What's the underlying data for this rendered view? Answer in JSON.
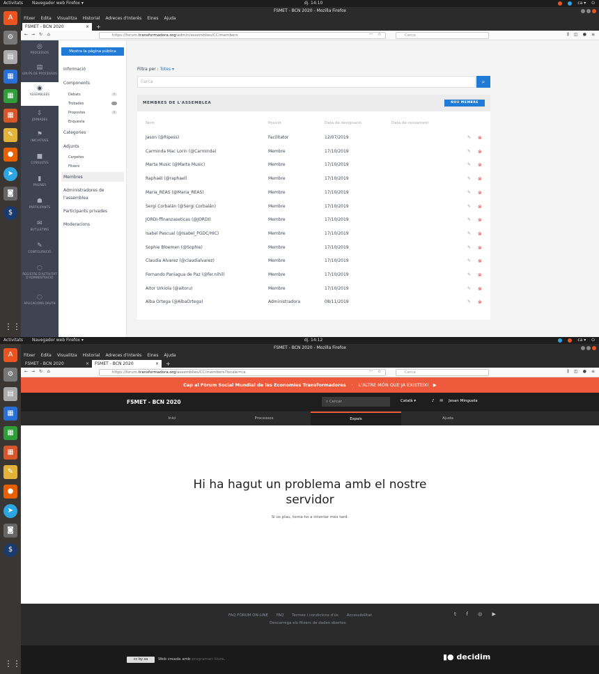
{
  "desktop": {
    "activities": "Activitats",
    "app_label": "Navegador web Firefox ▾",
    "shot1_time": "dj. 14:10",
    "shot2_time": "dj. 14:12",
    "tray_lang": "ca ▾",
    "window_title": "FSMET - BCN 2020 - Mozilla Firefox"
  },
  "browser": {
    "menu": [
      "Fitxer",
      "Edita",
      "Visualitza",
      "Historial",
      "Adreces d'interès",
      "Eines",
      "Ajuda"
    ],
    "tab1_label": "FSMET - BCN 2020",
    "tab_close": "×",
    "newtab": "+",
    "url1_pre": "https://forum.",
    "url1_host": "transformadora.org",
    "url1_path": "/admin/assemblies/CC/members",
    "url2_pre": "https://forum.",
    "url2_host": "transformadora.org",
    "url2_path": "/assemblies/CC/members?locale=ca",
    "search_placeholder": "Cerca"
  },
  "admin": {
    "sidebar": [
      {
        "label": "PROCESSOS",
        "icon": "◎"
      },
      {
        "label": "GRUPS DE PROCESSOS",
        "icon": "▤"
      },
      {
        "label": "ASSEMBLEES",
        "icon": "◉"
      },
      {
        "label": "JORNADES",
        "icon": "⇩"
      },
      {
        "label": "INICIATIVES",
        "icon": "⚑"
      },
      {
        "label": "CONSULTES",
        "icon": "■"
      },
      {
        "label": "PÀGINES",
        "icon": "▮"
      },
      {
        "label": "PARTICIPANTS",
        "icon": "☗"
      },
      {
        "label": "BUTLLETINS",
        "icon": "✉"
      },
      {
        "label": "CONFIGURACIÓ",
        "icon": "✎"
      },
      {
        "label": "REGISTRE D'ACTIVITAT D'ADMINISTRACIÓ",
        "icon": "◌"
      },
      {
        "label": "APLICACIONS OAUTH",
        "icon": "◌"
      }
    ],
    "public_page_btn": "Mostra la pàgina pública",
    "submenu": {
      "informacio": "Informació",
      "components": "Components",
      "debats": "Debats",
      "trobades": "Trobades",
      "propostes": "Propostes",
      "enquesta": "Enquesta",
      "categories": "Categories",
      "adjunts": "Adjunts",
      "carpetes": "Carpetes",
      "fitxers": "Fitxers",
      "membres": "Membres",
      "administradors": "Administradores de",
      "administradors2": "l'assemblea",
      "participants_privades": "Participants privades",
      "moderacions": "Moderacions",
      "badge_debats": "0",
      "badge_propostes": "0"
    },
    "filter_label": "Filtra per :",
    "filter_value": "Totes ▾",
    "search_placeholder": "Cerca",
    "card_title": "MEMBRES DE L'ASSEMBLEA",
    "new_member_btn": "NOU MEMBRE",
    "columns": [
      "Nom",
      "Posició",
      "Data de designació",
      "Data de cessament"
    ],
    "members": [
      {
        "name": "Jason (@Ripess)",
        "role": "Facilitator",
        "date": "12/07/2019"
      },
      {
        "name": "Carminda Mac Lorin (@Carminda)",
        "role": "Membre",
        "date": "17/10/2019"
      },
      {
        "name": "Marta Music (@Marta Music)",
        "role": "Membre",
        "date": "17/10/2019"
      },
      {
        "name": "Raphaël (@raphael)",
        "role": "Membre",
        "date": "17/10/2019"
      },
      {
        "name": "Maria_REAS (@Maria_REAS)",
        "role": "Membre",
        "date": "17/10/2019"
      },
      {
        "name": "Sergi Corbalán (@Sergi Corbalán)",
        "role": "Membre",
        "date": "17/10/2019"
      },
      {
        "name": "JORDI-ffinanzaseticas (@JORDI)",
        "role": "Membre",
        "date": "17/10/2019"
      },
      {
        "name": "Isabel Pascual (@Isabel_PGDC/HIC)",
        "role": "Membre",
        "date": "17/10/2019"
      },
      {
        "name": "Sophie Bloemen (@Sophie)",
        "role": "Membre",
        "date": "17/10/2019"
      },
      {
        "name": "Claudia Alvarez (@claudialvarez)",
        "role": "Membre",
        "date": "17/10/2019"
      },
      {
        "name": "Fernando Paniagua de Paz (@fer.nihil)",
        "role": "Membre",
        "date": "17/10/2019"
      },
      {
        "name": "Aitor Urkiola (@aitoru)",
        "role": "Membre",
        "date": "17/10/2019"
      },
      {
        "name": "Alba Ortega (@AlbaOrtega)",
        "role": "Administradora",
        "date": "08/11/2019"
      }
    ]
  },
  "site": {
    "banner_text": "Cap al Fòrum Social Mundial de les Economies Transformadores",
    "banner_sep": "·",
    "banner_link": "L'ALTRE MÓN QUE JA EXISTEIX!",
    "banner_arrow": "▶",
    "logo": "FSMET - BCN 2020",
    "search_placeholder": "Cercar",
    "lang": "Català ▾",
    "user": "Josan Minguela",
    "nav": [
      "Inici",
      "Processos",
      "Espais",
      "Ajuda"
    ],
    "error_title": "Hi ha hagut un problema amb el nostre servidor",
    "error_sub": "Si us plau, torna-ho a intentar més tard.",
    "footer_links": [
      "FAQ FÒRUM ON-LINE",
      "FAQ",
      "Termes i condicions d'ús",
      "Accessibilitat"
    ],
    "footer_download": "Descarrega els fitxers de dades obertes",
    "social": "𝕥 f ◎ ▶",
    "cc": "cc by sa",
    "made_with": "Web creada amb",
    "made_link": "programari lliure",
    "made_dot": ".",
    "decidim": "▮● decidim"
  }
}
